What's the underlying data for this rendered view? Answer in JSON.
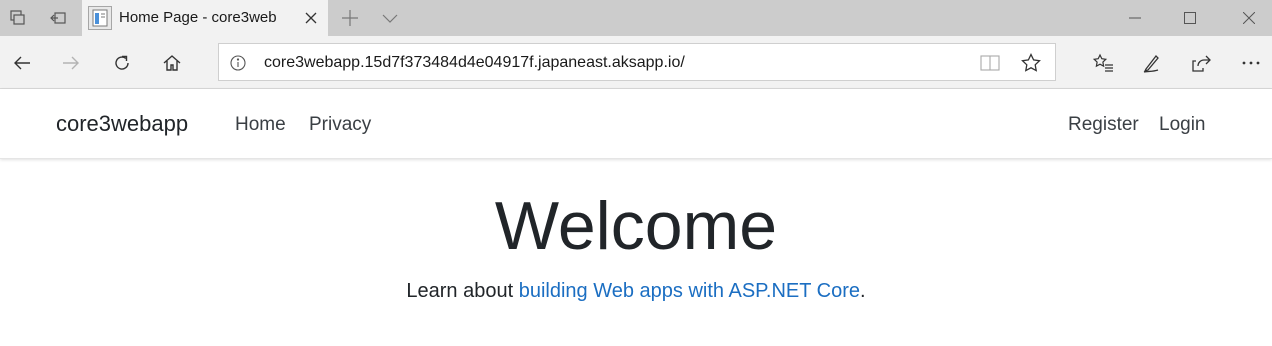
{
  "browser": {
    "tab": {
      "title": "Home Page - core3web"
    },
    "address": {
      "url": "core3webapp.15d7f373484d4e04917f.japaneast.aksapp.io/"
    },
    "icons": {
      "tabs_aside": "tabs-aside-icon",
      "set_aside": "set-aside-icon",
      "new_tab": "plus-icon",
      "tab_list": "chevron-down-icon",
      "back": "arrow-left-icon",
      "forward": "arrow-right-icon",
      "refresh": "refresh-icon",
      "home": "home-icon",
      "info": "info-icon",
      "reading_view": "book-icon",
      "favorite": "star-icon",
      "favorites": "favorites-list-icon",
      "notes": "pen-icon",
      "share": "share-icon",
      "more": "ellipsis-icon"
    }
  },
  "site": {
    "brand": "core3webapp",
    "nav": [
      "Home",
      "Privacy"
    ],
    "auth": [
      "Register",
      "Login"
    ],
    "heading": "Welcome",
    "lead_prefix": "Learn about ",
    "lead_link": "building Web apps with ASP.NET Core",
    "lead_suffix": ".",
    "colors": {
      "link": "#1b6ec2",
      "text": "#212529",
      "chrome": "#cccccc",
      "toolbar": "#f2f2f2"
    }
  }
}
